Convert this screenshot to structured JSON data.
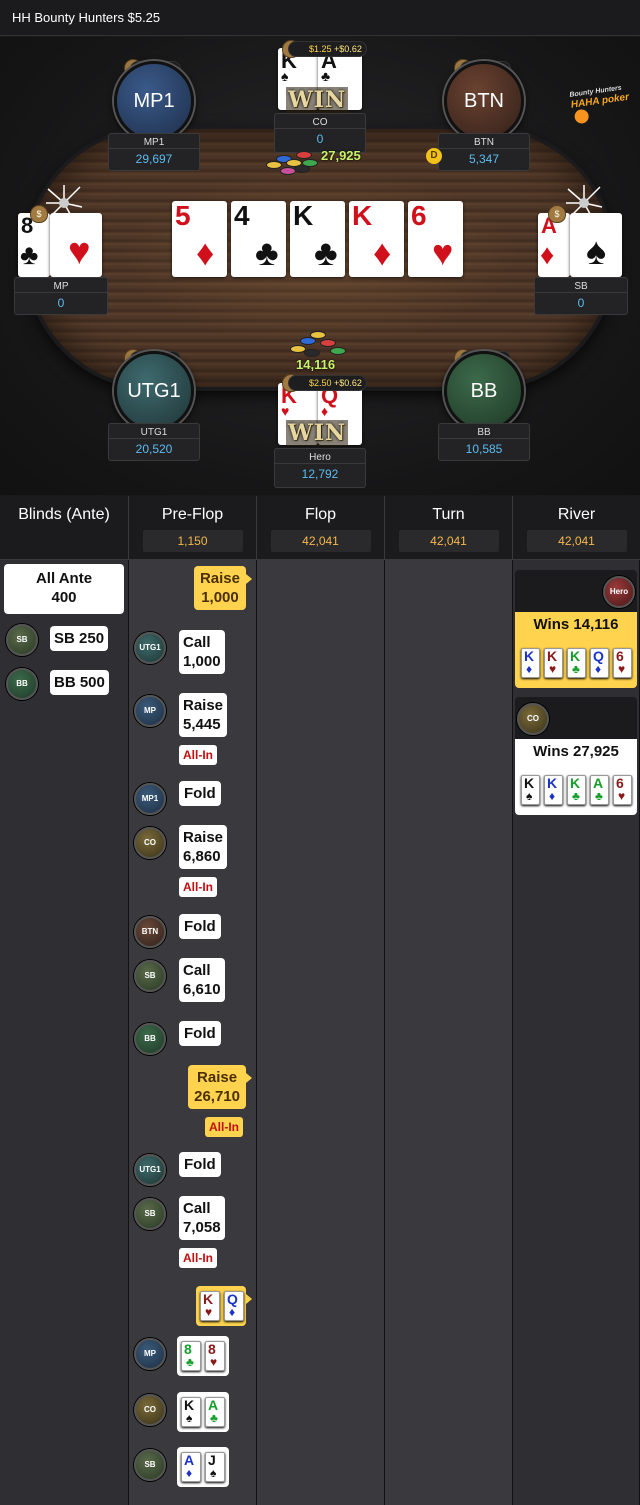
{
  "header": {
    "title": "HH  Bounty Hunters $5.25"
  },
  "logo": {
    "top": "Bounty Hunters",
    "name": "HAHA poker"
  },
  "seats": {
    "mp1": {
      "avatar": "MP1",
      "name": "MP1",
      "stack": "29,697",
      "bounty": "$2.50"
    },
    "co": {
      "name": "CO",
      "stack": "0",
      "bounty": "$1.25",
      "bounty_won": "+$0.62",
      "win": "WIN"
    },
    "btn": {
      "avatar": "BTN",
      "name": "BTN",
      "stack": "5,347",
      "bounty": "$1.25",
      "dealer": "D"
    },
    "mp": {
      "name": "MP",
      "stack": "0"
    },
    "sb": {
      "name": "SB",
      "stack": "0"
    },
    "utg1": {
      "avatar": "UTG1",
      "name": "UTG1",
      "stack": "20,520",
      "bounty": "$1.25"
    },
    "hero": {
      "name": "Hero",
      "stack": "12,792",
      "bounty": "$2.50",
      "bounty_won": "+$0.62",
      "win": "WIN"
    },
    "bb": {
      "avatar": "BB",
      "name": "BB",
      "stack": "10,585",
      "bounty": "$1.25"
    }
  },
  "pots": {
    "main": "27,925",
    "side": "14,116"
  },
  "board": [
    {
      "rank": "5",
      "suit": "♦",
      "color": "#d0101a"
    },
    {
      "rank": "4",
      "suit": "♣",
      "color": "#111111"
    },
    {
      "rank": "K",
      "suit": "♣",
      "color": "#111111"
    },
    {
      "rank": "K",
      "suit": "♦",
      "color": "#d0101a"
    },
    {
      "rank": "6",
      "suit": "♥",
      "color": "#d0101a"
    }
  ],
  "hole_cards": {
    "co": [
      {
        "rank": "K",
        "suit": "♠"
      },
      {
        "rank": "A",
        "suit": "♣"
      }
    ],
    "hero": [
      {
        "rank": "K",
        "suit": "♥"
      },
      {
        "rank": "Q",
        "suit": "♦"
      }
    ],
    "mp": [
      {
        "rank": "8",
        "suit": "♣"
      },
      {
        "rank": "",
        "suit": "♥"
      }
    ],
    "sb": [
      {
        "rank": "A",
        "suit": "♦"
      },
      {
        "rank": "",
        "suit": "♠"
      }
    ]
  },
  "streets": {
    "blinds": {
      "label": "Blinds (Ante)"
    },
    "preflop": {
      "label": "Pre-Flop",
      "pot": "1,150"
    },
    "flop": {
      "label": "Flop",
      "pot": "42,041"
    },
    "turn": {
      "label": "Turn",
      "pot": "42,041"
    },
    "river": {
      "label": "River",
      "pot": "42,041"
    }
  },
  "blinds_col": {
    "ante_line1": "All Ante",
    "ante_line2": "400",
    "sb": {
      "pos": "SB",
      "text": "SB  250"
    },
    "bb": {
      "pos": "BB",
      "text": "BB  500"
    }
  },
  "actions": [
    {
      "pos": "",
      "l1": "Raise",
      "l2": "1,000",
      "hero": true
    },
    {
      "pos": "UTG1",
      "l1": "Call",
      "l2": "1,000"
    },
    {
      "pos": "MP",
      "l1": "Raise",
      "l2": "5,445",
      "allin": "All-In"
    },
    {
      "pos": "MP1",
      "l1": "Fold"
    },
    {
      "pos": "CO",
      "l1": "Raise",
      "l2": "6,860",
      "allin": "All-In"
    },
    {
      "pos": "BTN",
      "l1": "Fold"
    },
    {
      "pos": "SB",
      "l1": "Call",
      "l2": "6,610"
    },
    {
      "pos": "BB",
      "l1": "Fold"
    },
    {
      "pos": "",
      "l1": "Raise",
      "l2": "26,710",
      "allin": "All-In",
      "hero": true
    },
    {
      "pos": "UTG1",
      "l1": "Fold"
    },
    {
      "pos": "SB",
      "l1": "Call",
      "l2": "7,058",
      "allin": "All-In"
    }
  ],
  "showdown": [
    {
      "pos": "",
      "cards": [
        {
          "rank": "K",
          "suit": "♥"
        },
        {
          "rank": "Q",
          "suit": "♦"
        }
      ]
    },
    {
      "pos": "MP",
      "cards": [
        {
          "rank": "8",
          "suit": "♣"
        },
        {
          "rank": "8",
          "suit": "♥"
        }
      ]
    },
    {
      "pos": "CO",
      "cards": [
        {
          "rank": "K",
          "suit": "♠"
        },
        {
          "rank": "A",
          "suit": "♣"
        }
      ]
    },
    {
      "pos": "SB",
      "cards": [
        {
          "rank": "A",
          "suit": "♦"
        },
        {
          "rank": "J",
          "suit": "♠"
        }
      ]
    }
  ],
  "river_results": [
    {
      "player": "Hero",
      "text": "Wins 14,116",
      "cards": [
        {
          "rank": "K",
          "suit": "♦"
        },
        {
          "rank": "K",
          "suit": "♥"
        },
        {
          "rank": "K",
          "suit": "♣"
        },
        {
          "rank": "Q",
          "suit": "♦"
        },
        {
          "rank": "6",
          "suit": "♥"
        }
      ]
    },
    {
      "player": "CO",
      "text": "Wins 27,925",
      "cards": [
        {
          "rank": "K",
          "suit": "♠"
        },
        {
          "rank": "K",
          "suit": "♦"
        },
        {
          "rank": "K",
          "suit": "♣"
        },
        {
          "rank": "A",
          "suit": "♣"
        },
        {
          "rank": "6",
          "suit": "♥"
        }
      ]
    }
  ],
  "suit_colors": {
    "♠": "#111111",
    "♥": "#8a1a1a",
    "♦": "#1b34c8",
    "♣": "#169e2b"
  }
}
